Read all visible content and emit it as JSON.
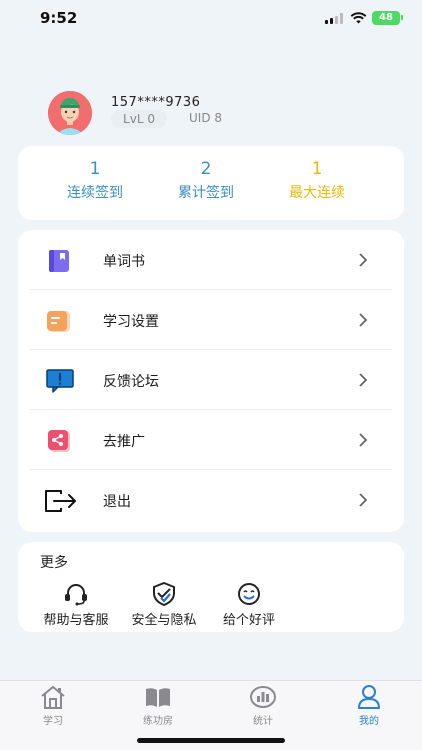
{
  "status_bar": {
    "time": "9:52",
    "battery": "48"
  },
  "profile": {
    "phone": "157****9736",
    "level": "LvL 0",
    "uid": "UID 8"
  },
  "stats": [
    {
      "value": "1",
      "label": "连续签到",
      "color": "#3b8fc4"
    },
    {
      "value": "2",
      "label": "累计签到",
      "color": "#3b8fc4"
    },
    {
      "value": "1",
      "label": "最大连续",
      "color": "#f2b705"
    }
  ],
  "menu": [
    {
      "label": "单词书",
      "icon": "book-icon"
    },
    {
      "label": "学习设置",
      "icon": "folder-icon"
    },
    {
      "label": "反馈论坛",
      "icon": "feedback-icon"
    },
    {
      "label": "去推广",
      "icon": "share-icon"
    },
    {
      "label": "退出",
      "icon": "logout-icon"
    }
  ],
  "more": {
    "title": "更多",
    "items": [
      {
        "label": "帮助与客服",
        "icon": "headset-icon"
      },
      {
        "label": "安全与隐私",
        "icon": "shield-icon"
      },
      {
        "label": "给个好评",
        "icon": "smile-icon"
      }
    ]
  },
  "tabs": [
    {
      "label": "学习",
      "icon": "home-icon",
      "active": false
    },
    {
      "label": "练功房",
      "icon": "open-book-icon",
      "active": false
    },
    {
      "label": "统计",
      "icon": "stats-icon",
      "active": false
    },
    {
      "label": "我的",
      "icon": "user-icon",
      "active": true
    }
  ],
  "colors": {
    "accent": "#3b8fc4",
    "gold": "#f2b705",
    "inactive": "#8a8a8e",
    "background": "#eef4f8"
  }
}
